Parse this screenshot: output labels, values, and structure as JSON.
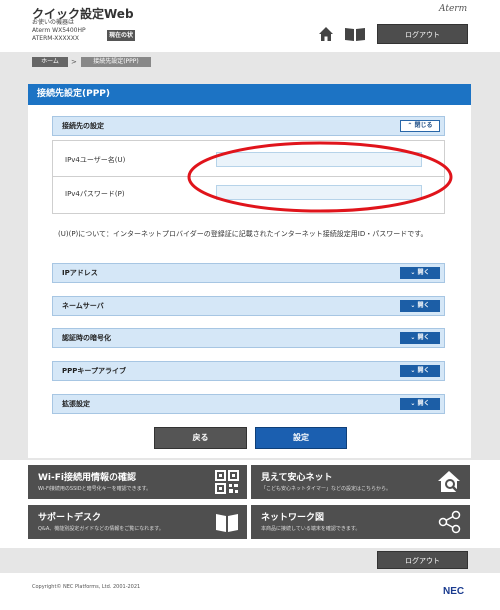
{
  "header": {
    "app_title": "クイック設定Web",
    "device_lines": [
      "お使いの機器は",
      "Aterm WX5400HP",
      "ATERM-XXXXXX"
    ],
    "status_button": "現在の状態",
    "brand": "Aterm",
    "home_icon": "home-icon",
    "manual_icon": "book-icon",
    "logout": "ログアウト"
  },
  "breadcrumb": {
    "home": "ホーム",
    "separator": ">",
    "current": "接続先設定(PPP)"
  },
  "page": {
    "title": "接続先設定(PPP)"
  },
  "connection_section": {
    "title": "接続先の設定",
    "toggle": "閉じる",
    "fields": [
      {
        "label": "IPv4ユーザー名(U)",
        "value": ""
      },
      {
        "label": "IPv4パスワード(P)",
        "value": ""
      }
    ],
    "note": "(U)(P)について：インターネットプロバイダーの登録証に記載されたインターネット接続設定用ID・パスワードです。"
  },
  "collapsed_sections": [
    {
      "title": "IPアドレス",
      "toggle": "開く"
    },
    {
      "title": "ネームサーバ",
      "toggle": "開く"
    },
    {
      "title": "認証時の暗号化",
      "toggle": "開く"
    },
    {
      "title": "PPPキープアライブ",
      "toggle": "開く"
    },
    {
      "title": "拡張設定",
      "toggle": "開く"
    }
  ],
  "actions": {
    "back": "戻る",
    "set": "設定"
  },
  "tiles": [
    {
      "title": "Wi-Fi接続用情報の確認",
      "desc": "Wi-Fi接続用のSSIDと暗号化キーを確認できます。",
      "icon": "qr-code-icon"
    },
    {
      "title": "見えて安心ネット",
      "desc": "「こども安心ネットタイマー」などの設定はこちらから。",
      "icon": "house-search-icon"
    },
    {
      "title": "サポートデスク",
      "desc": "Q&A、機能別設定ガイドなどの情報をご覧になれます。",
      "icon": "open-book-icon"
    },
    {
      "title": "ネットワーク図",
      "desc": "本商品に接続している端末を確認できます。",
      "icon": "network-icon"
    }
  ],
  "footer": {
    "logout": "ログアウト",
    "copyright": "Copyright© NEC Platforms, Ltd. 2001-2021",
    "logo": "NEC"
  },
  "colors": {
    "accent_blue": "#1c73c4",
    "section_bg": "#d5e7f7",
    "tile_bg": "#4f4f4f",
    "highlight_red": "#e0141b"
  }
}
